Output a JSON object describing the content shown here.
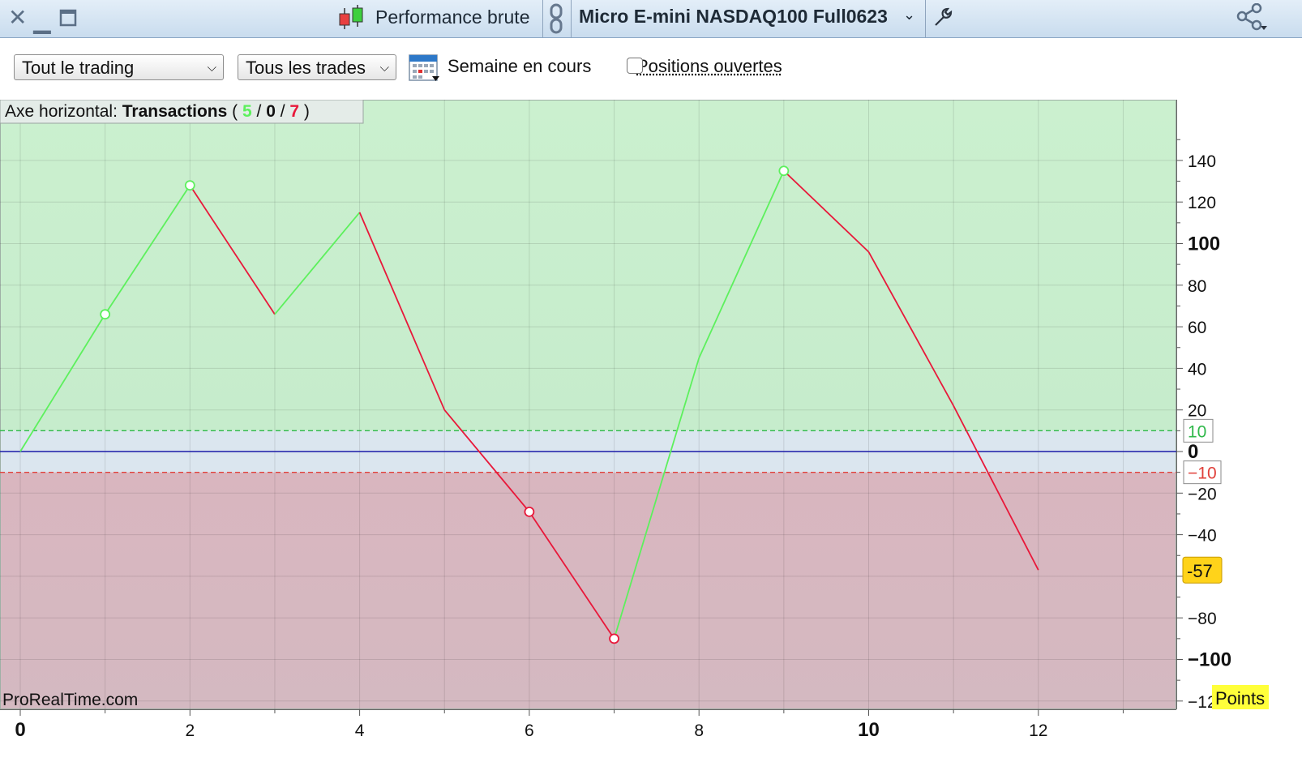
{
  "window": {
    "close_icon": "close-icon",
    "minimize_icon": "minimize-icon",
    "maximize_icon": "maximize-icon",
    "module_icon": "candlestick-icon",
    "module_title": "Performance brute",
    "link_icon": "link-icon",
    "instrument": "Micro E-mini NASDAQ100 Full0623",
    "wrench_icon": "wrench-icon",
    "share_icon": "share-icon"
  },
  "toolbar": {
    "trading_filter": "Tout le trading",
    "trades_filter": "Tous les trades",
    "calendar_icon": "calendar-icon",
    "period_label": "Semaine en cours",
    "open_positions_label": "Positions ouvertes",
    "open_positions_checked": false
  },
  "chart_data": {
    "type": "line",
    "legend": {
      "prefix": "Axe horizontal:",
      "name": "Transactions",
      "open": "(",
      "wins": "5",
      "sep1": "/",
      "neutral": "0",
      "sep2": "/",
      "losses": "7",
      "close": ")"
    },
    "x": [
      0,
      1,
      2,
      3,
      4,
      5,
      6,
      7,
      8,
      9,
      10,
      11,
      12
    ],
    "y": [
      0,
      66,
      128,
      66,
      115,
      20,
      -29,
      -90,
      45,
      135,
      96,
      22,
      -57
    ],
    "segment_result": [
      "win",
      "win",
      "loss",
      "win",
      "loss",
      "loss",
      "loss",
      "win",
      "win",
      "loss",
      "loss",
      "loss"
    ],
    "markers": [
      {
        "x": 1,
        "y": 66,
        "result": "win"
      },
      {
        "x": 2,
        "y": 128,
        "result": "win"
      },
      {
        "x": 6,
        "y": -29,
        "result": "loss"
      },
      {
        "x": 7,
        "y": -90,
        "result": "loss"
      },
      {
        "x": 9,
        "y": 135,
        "result": "win"
      }
    ],
    "xlim": [
      0,
      13.5
    ],
    "ylim": [
      -124,
      160
    ],
    "x_ticks": [
      {
        "value": 0,
        "label": "0",
        "bold": true
      },
      {
        "value": 2,
        "label": "2"
      },
      {
        "value": 4,
        "label": "4"
      },
      {
        "value": 6,
        "label": "6"
      },
      {
        "value": 8,
        "label": "8"
      },
      {
        "value": 10,
        "label": "10",
        "bold": true
      },
      {
        "value": 12,
        "label": "12"
      }
    ],
    "y_ticks": [
      {
        "value": 140,
        "label": "140"
      },
      {
        "value": 120,
        "label": "120"
      },
      {
        "value": 100,
        "label": "100",
        "bold": true
      },
      {
        "value": 80,
        "label": "80"
      },
      {
        "value": 60,
        "label": "60"
      },
      {
        "value": 40,
        "label": "40"
      },
      {
        "value": 20,
        "label": "20"
      },
      {
        "value": 0,
        "label": "0",
        "bold": true
      },
      {
        "value": -20,
        "label": "−20"
      },
      {
        "value": -40,
        "label": "−40"
      },
      {
        "value": -60,
        "label": "−60"
      },
      {
        "value": -80,
        "label": "−80"
      },
      {
        "value": -100,
        "label": "−100",
        "bold": true
      },
      {
        "value": -120,
        "label": "−12"
      }
    ],
    "thresholds": [
      {
        "value": 10,
        "label": "10",
        "color": "#2fb84a"
      },
      {
        "value": -10,
        "label": "−10",
        "color": "#e0403a"
      }
    ],
    "last_value": {
      "value": -57,
      "label": "-57"
    },
    "unit_label": "Points",
    "watermark": "ProRealTime.com",
    "grid": true,
    "colors": {
      "win": "#5df05d",
      "loss": "#e8183a",
      "zero_line": "#1a1aa8",
      "positive_zone": "#c6eccc",
      "neutral_zone": "#dbe6ef",
      "negative_zone": "#d9b6bf",
      "last_value_bg": "#ffd31a",
      "unit_bg": "#ffff3a"
    }
  }
}
